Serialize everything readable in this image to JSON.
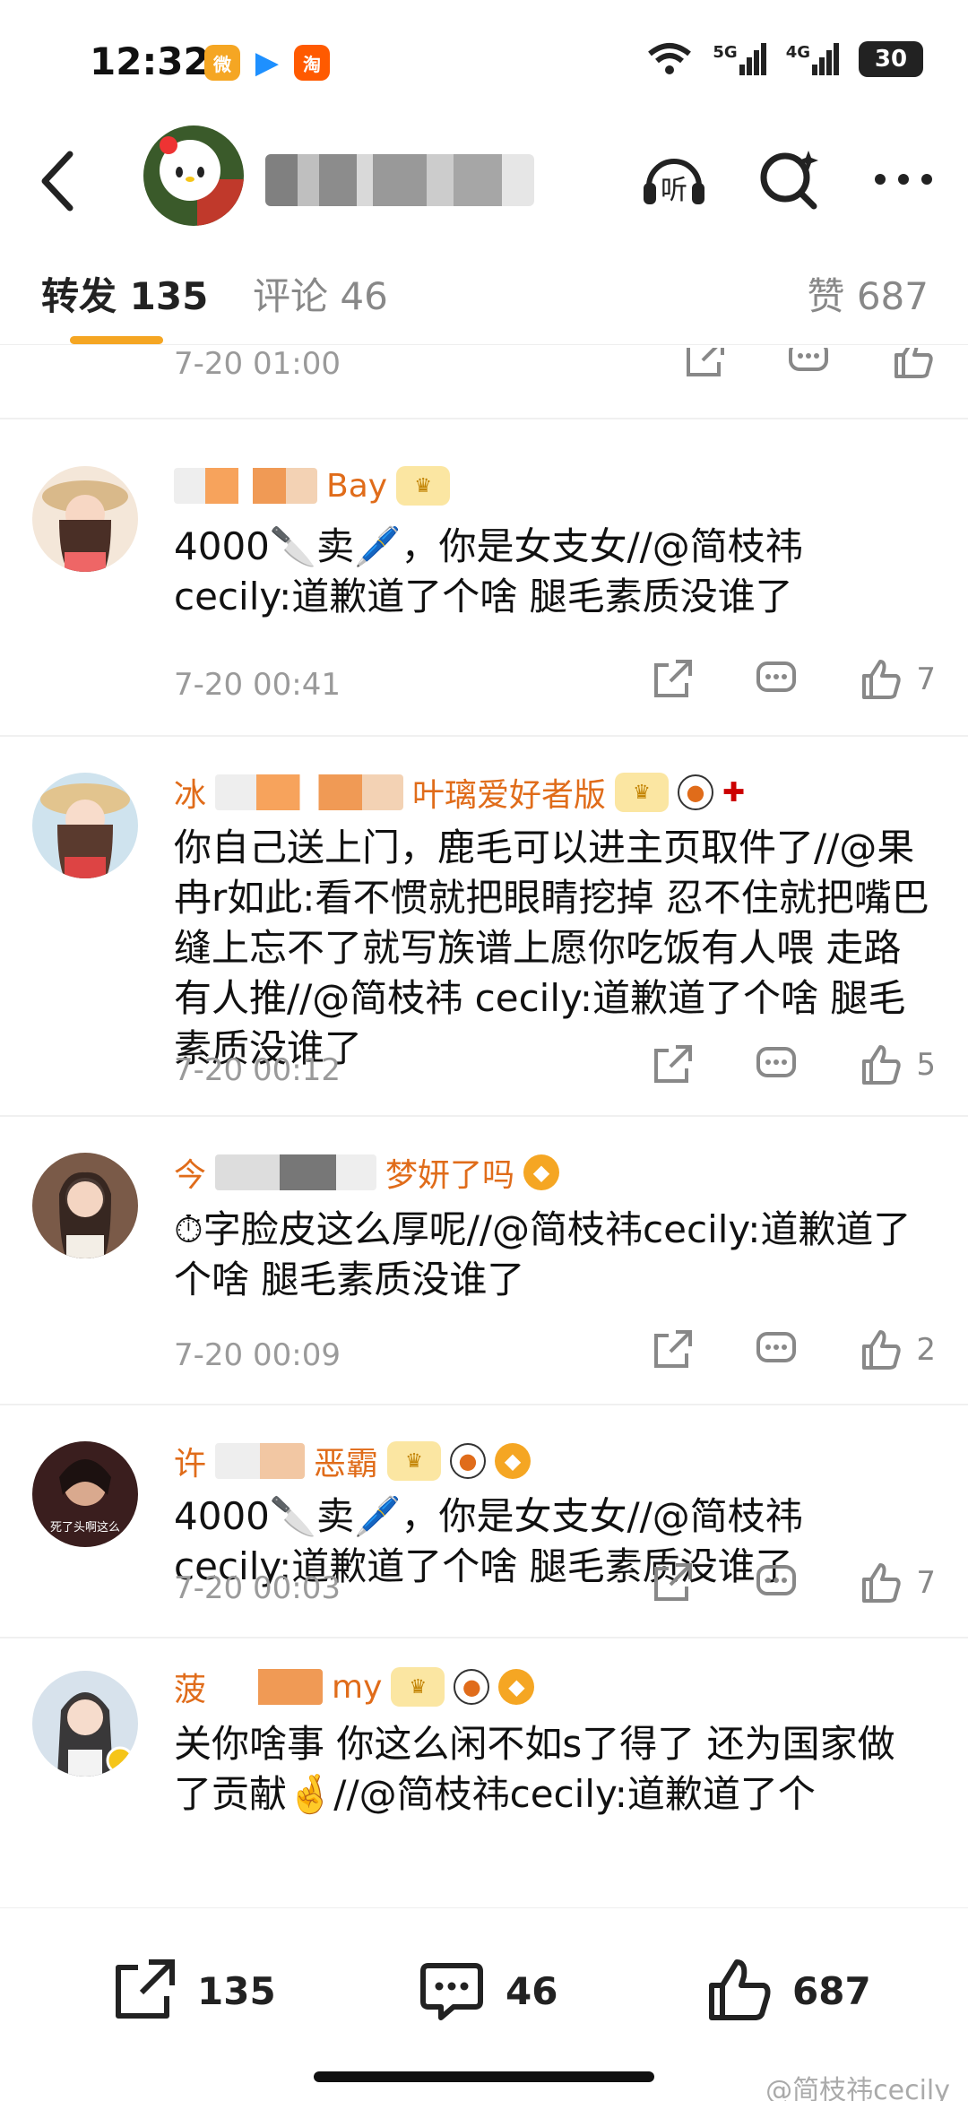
{
  "status": {
    "time": "12:32",
    "battery": "30",
    "net1": "5G",
    "net2": "4G",
    "app_taobao": "淘"
  },
  "header": {
    "listen_label": "听"
  },
  "tabs": [
    {
      "label": "转发 135"
    },
    {
      "label": "评论 46"
    },
    {
      "label": "赞 687"
    }
  ],
  "top_partial": {
    "time": "7-20 01:00"
  },
  "items": [
    {
      "name_tail": "Bay",
      "body": "4000🔪卖🖊️，你是女支女//@简枝祎 cecily:道歉道了个啥 腿毛素质没谁了",
      "body_at": "@简枝祎 cecily",
      "time": "7-20 00:41",
      "likes": "7"
    },
    {
      "name_head": "冰",
      "name_tail": "叶璃爱好者版",
      "body": "你自己送上门，鹿毛可以进主页取件了//@果冉r如此:看不惯就把眼睛挖掉 忍不住就把嘴巴缝上忘不了就写族谱上愿你吃饭有人喂 走路有人推//@简枝祎 cecily:道歉道了个啥 腿毛素质没谁了",
      "time": "7-20 00:12",
      "likes": "5"
    },
    {
      "name_head": "今",
      "name_tail": "梦妍了吗",
      "body": "⏱字脸皮这么厚呢//@简枝祎cecily:道歉道了个啥 腿毛素质没谁了",
      "time": "7-20 00:09",
      "likes": "2"
    },
    {
      "name_head": "许",
      "name_tail": "恶霸",
      "avatar_caption": "死了头啊这么",
      "body": "4000🔪卖🖊️，你是女支女//@简枝祎 cecily:道歉道了个啥 腿毛素质没谁了",
      "time": "7-20 00:03",
      "likes": "7"
    },
    {
      "name_head": "菠",
      "name_tail": "my",
      "body": "关你啥事 你这么闲不如s了得了 还为国家做了贡献🤞//@简枝祎cecily:道歉道了个"
    }
  ],
  "bottom": {
    "repost": "135",
    "comment": "46",
    "like": "687"
  },
  "watermark": "@简枝祎cecily"
}
